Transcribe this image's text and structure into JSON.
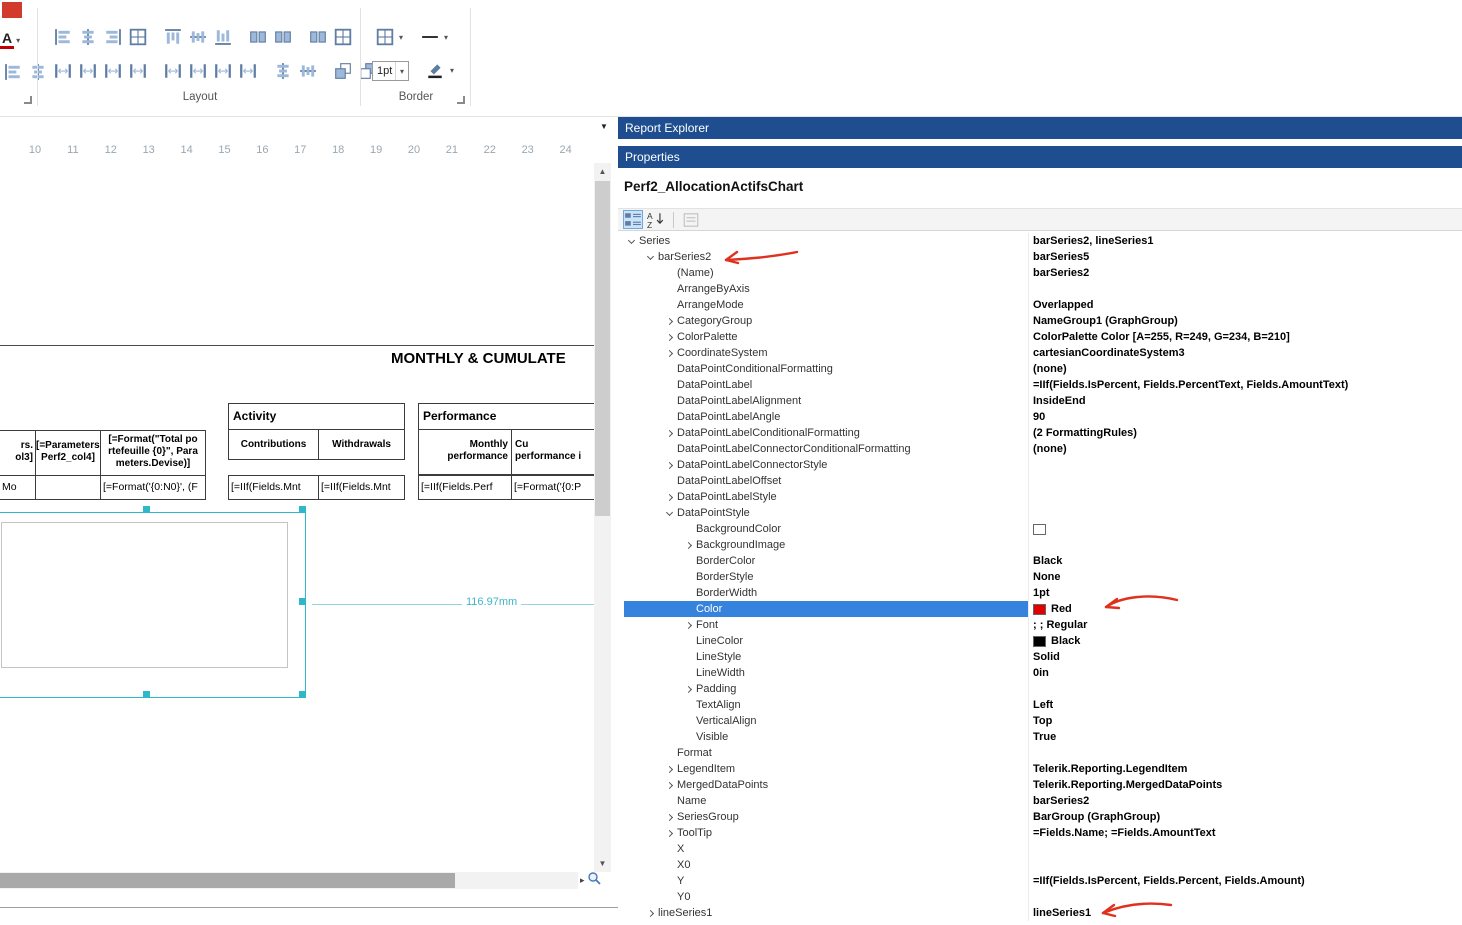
{
  "colors": {
    "panel_header_blue": "#1e4e8f",
    "grid_selection_blue": "#3583dc",
    "selection_handle_teal": "#2eb8c9",
    "color_value_red": "#e00000",
    "annotation_red": "#e0301e"
  },
  "ribbon": {
    "left_partial": {
      "swatch_color": "#d23a2e",
      "font_button_letter": "A",
      "icons": [
        {
          "name": "align-text-left-icon",
          "glyph": "al"
        },
        {
          "name": "align-text-justify-icon",
          "glyph": "ac"
        }
      ]
    },
    "group_layout": {
      "label": "Layout",
      "row1": [
        [
          {
            "name": "align-lefts-icon",
            "glyph": "al"
          },
          {
            "name": "align-centers-icon",
            "glyph": "ac"
          },
          {
            "name": "align-rights-icon",
            "glyph": "ar"
          },
          {
            "name": "align-to-grid-icon",
            "glyph": "gr"
          }
        ],
        [
          {
            "name": "align-tops-icon",
            "glyph": "at"
          },
          {
            "name": "align-middles-icon",
            "glyph": "am"
          },
          {
            "name": "align-bottoms-icon",
            "glyph": "ab"
          }
        ],
        [
          {
            "name": "make-same-width-icon",
            "glyph": "bx"
          },
          {
            "name": "make-same-height-icon",
            "glyph": "bx"
          }
        ],
        [
          {
            "name": "make-same-size-icon",
            "glyph": "bx"
          },
          {
            "name": "size-to-grid-icon",
            "glyph": "gr"
          }
        ]
      ],
      "row2": [
        [
          {
            "name": "equal-horizontal-spacing-icon",
            "glyph": "sp"
          },
          {
            "name": "increase-horizontal-spacing-icon",
            "glyph": "sp"
          },
          {
            "name": "decrease-horizontal-spacing-icon",
            "glyph": "sp"
          },
          {
            "name": "remove-horizontal-spacing-icon",
            "glyph": "sp"
          }
        ],
        [
          {
            "name": "equal-vertical-spacing-icon",
            "glyph": "sp"
          },
          {
            "name": "increase-vertical-spacing-icon",
            "glyph": "sp"
          },
          {
            "name": "decrease-vertical-spacing-icon",
            "glyph": "sp"
          },
          {
            "name": "remove-vertical-spacing-icon",
            "glyph": "sp"
          }
        ],
        [
          {
            "name": "center-horizontally-icon",
            "glyph": "ac"
          },
          {
            "name": "center-vertically-icon",
            "glyph": "am"
          }
        ],
        [
          {
            "name": "bring-to-front-icon",
            "glyph": "lf"
          },
          {
            "name": "send-to-back-icon",
            "glyph": "lb"
          }
        ]
      ]
    },
    "group_border": {
      "label": "Border",
      "width_value": "1pt",
      "buttons": [
        {
          "name": "borders-icon",
          "glyph": "gr"
        },
        {
          "name": "line-style-icon",
          "glyph": "ln"
        },
        {
          "name": "line-color-icon",
          "glyph": "pn"
        }
      ]
    }
  },
  "canvas": {
    "ruler": [
      "10",
      "11",
      "12",
      "13",
      "14",
      "15",
      "16",
      "17",
      "18",
      "19",
      "20",
      "21",
      "22",
      "23",
      "24"
    ],
    "title": "MONTHLY & CUMULATE",
    "dimension": "116.97mm",
    "left_table": {
      "header": [
        "rs.\nol3]",
        "[=Parameters.\nPerf2_col4]",
        "[=Format(\"Total po\nrtefeuille {0}\", Para\nmeters.Devise)]"
      ],
      "row": [
        "Mo",
        "",
        "[=Format('{0:N0}', (F"
      ]
    },
    "activity_table": {
      "title": "Activity",
      "header": [
        "Contributions",
        "Withdrawals"
      ],
      "row": [
        "[=IIf(Fields.Mnt",
        "[=IIf(Fields.Mnt"
      ]
    },
    "performance_table": {
      "title": "Performance",
      "header": [
        "Monthly\nperformance",
        "Cu\nperformance i"
      ],
      "row": [
        "[=IIf(Fields.Perf",
        "[=Format('{0:P"
      ]
    }
  },
  "panels": {
    "report_explorer_title": "Report Explorer",
    "properties_title": "Properties",
    "selected_object": "Perf2_AllocationActifsChart"
  },
  "property_grid": {
    "rows": [
      {
        "level": 0,
        "expand": "open",
        "name": "Series",
        "value": "barSeries2, lineSeries1"
      },
      {
        "level": 1,
        "expand": "open",
        "name": "barSeries2",
        "value": "barSeries5"
      },
      {
        "level": 2,
        "expand": "none",
        "name": "(Name)",
        "value": "barSeries2"
      },
      {
        "level": 2,
        "expand": "none",
        "name": "ArrangeByAxis",
        "value": ""
      },
      {
        "level": 2,
        "expand": "none",
        "name": "ArrangeMode",
        "value": "Overlapped"
      },
      {
        "level": 2,
        "expand": "closed",
        "name": "CategoryGroup",
        "value": "NameGroup1 (GraphGroup)"
      },
      {
        "level": 2,
        "expand": "closed",
        "name": "ColorPalette",
        "value": "ColorPalette Color [A=255, R=249, G=234, B=210]"
      },
      {
        "level": 2,
        "expand": "closed",
        "name": "CoordinateSystem",
        "value": "cartesianCoordinateSystem3"
      },
      {
        "level": 2,
        "expand": "none",
        "name": "DataPointConditionalFormatting",
        "value": "(none)"
      },
      {
        "level": 2,
        "expand": "none",
        "name": "DataPointLabel",
        "value": "=IIf(Fields.IsPercent, Fields.PercentText, Fields.AmountText)"
      },
      {
        "level": 2,
        "expand": "none",
        "name": "DataPointLabelAlignment",
        "value": "InsideEnd"
      },
      {
        "level": 2,
        "expand": "none",
        "name": "DataPointLabelAngle",
        "value": "90"
      },
      {
        "level": 2,
        "expand": "closed",
        "name": "DataPointLabelConditionalFormatting",
        "value": "(2 FormattingRules)"
      },
      {
        "level": 2,
        "expand": "none",
        "name": "DataPointLabelConnectorConditionalFormatting",
        "value": "(none)"
      },
      {
        "level": 2,
        "expand": "closed",
        "name": "DataPointLabelConnectorStyle",
        "value": ""
      },
      {
        "level": 2,
        "expand": "none",
        "name": "DataPointLabelOffset",
        "value": ""
      },
      {
        "level": 2,
        "expand": "closed",
        "name": "DataPointLabelStyle",
        "value": ""
      },
      {
        "level": 2,
        "expand": "open",
        "name": "DataPointStyle",
        "value": ""
      },
      {
        "level": 3,
        "expand": "none",
        "name": "BackgroundColor",
        "value": "",
        "swatch": "#ffffff"
      },
      {
        "level": 3,
        "expand": "closed",
        "name": "BackgroundImage",
        "value": ""
      },
      {
        "level": 3,
        "expand": "none",
        "name": "BorderColor",
        "value": "Black"
      },
      {
        "level": 3,
        "expand": "none",
        "name": "BorderStyle",
        "value": "None"
      },
      {
        "level": 3,
        "expand": "none",
        "name": "BorderWidth",
        "value": "1pt"
      },
      {
        "level": 3,
        "expand": "none",
        "name": "Color",
        "value": "Red",
        "swatch": "#e00000",
        "selected": true
      },
      {
        "level": 3,
        "expand": "closed",
        "name": "Font",
        "value": "; ; Regular"
      },
      {
        "level": 3,
        "expand": "none",
        "name": "LineColor",
        "value": "Black",
        "swatch": "#000000"
      },
      {
        "level": 3,
        "expand": "none",
        "name": "LineStyle",
        "value": "Solid"
      },
      {
        "level": 3,
        "expand": "none",
        "name": "LineWidth",
        "value": "0in"
      },
      {
        "level": 3,
        "expand": "closed",
        "name": "Padding",
        "value": ""
      },
      {
        "level": 3,
        "expand": "none",
        "name": "TextAlign",
        "value": "Left"
      },
      {
        "level": 3,
        "expand": "none",
        "name": "VerticalAlign",
        "value": "Top"
      },
      {
        "level": 3,
        "expand": "none",
        "name": "Visible",
        "value": "True"
      },
      {
        "level": 2,
        "expand": "none",
        "name": "Format",
        "value": ""
      },
      {
        "level": 2,
        "expand": "closed",
        "name": "LegendItem",
        "value": "Telerik.Reporting.LegendItem"
      },
      {
        "level": 2,
        "expand": "closed",
        "name": "MergedDataPoints",
        "value": "Telerik.Reporting.MergedDataPoints"
      },
      {
        "level": 2,
        "expand": "none",
        "name": "Name",
        "value": "barSeries2"
      },
      {
        "level": 2,
        "expand": "closed",
        "name": "SeriesGroup",
        "value": "BarGroup (GraphGroup)"
      },
      {
        "level": 2,
        "expand": "closed",
        "name": "ToolTip",
        "value": "=Fields.Name; =Fields.AmountText"
      },
      {
        "level": 2,
        "expand": "none",
        "name": "X",
        "value": ""
      },
      {
        "level": 2,
        "expand": "none",
        "name": "X0",
        "value": ""
      },
      {
        "level": 2,
        "expand": "none",
        "name": "Y",
        "value": "=IIf(Fields.IsPercent, Fields.Percent, Fields.Amount)"
      },
      {
        "level": 2,
        "expand": "none",
        "name": "Y0",
        "value": ""
      },
      {
        "level": 1,
        "expand": "closed",
        "name": "lineSeries1",
        "value": "lineSeries1"
      }
    ]
  }
}
